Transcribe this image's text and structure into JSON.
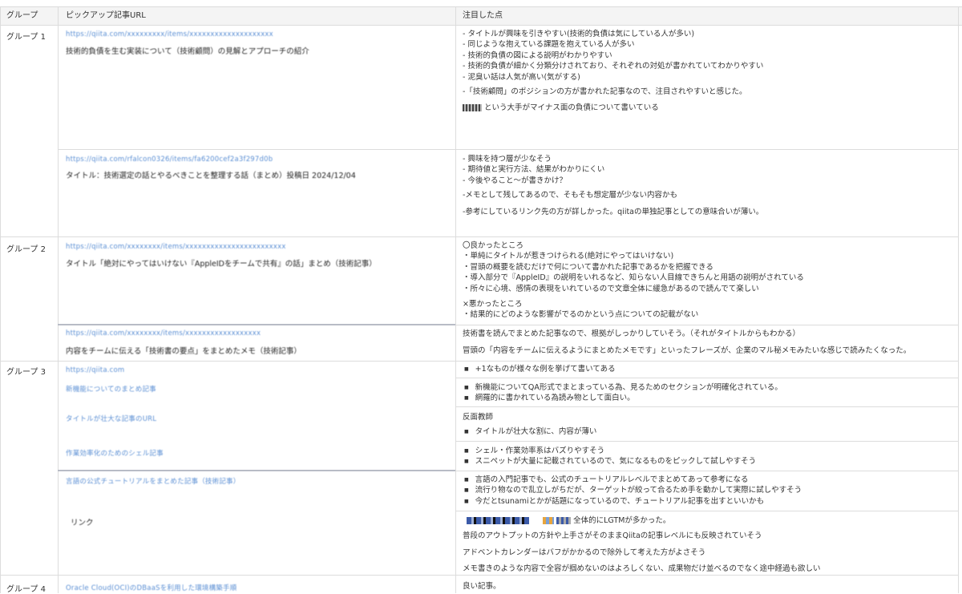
{
  "headers": {
    "group": "グループ",
    "url": "ピックアップ記事URL",
    "notes": "注目した点"
  },
  "groups": [
    "グループ 1",
    "グループ 2",
    "グループ 3",
    "グループ 4"
  ],
  "rows": {
    "r1": {
      "url": "https://qiita.com/xxxxxxxxx/items/xxxxxxxxxxxxxxxxxxxx",
      "title": "技術的負債を生む実装について（技術顧問）の見解とアプローチの紹介",
      "notes": [
        "- タイトルが興味を引きやすい(技術的負債は気にしている人が多い)",
        "- 同じような抱えている課題を抱えている人が多い",
        "- 技術的負債の図による説明がわかりやすい",
        "- 技術的負債が細かく分類分けされており、それぞれの対処が書かれていてわかりやすい",
        "- 泥臭い話は人気が高い(気がする)"
      ],
      "note2": "-「技術顧問」のポジションの方が書かれた記事なので、注目されやすいと感じた。",
      "note3": "という大手がマイナス面の負債について書いている"
    },
    "r2": {
      "url": "https://qiita.com/rfalcon0326/items/fa6200cef2a3f297d0b",
      "title": "タイトル：技術選定の話とやるべきことを整理する話（まとめ）投稿日 2024/12/04",
      "notes": [
        "- 興味を持つ層が少なそう",
        "- 期待値と実行方法、結果がわかりにくい",
        "- 今後やること～が書きかけ？"
      ],
      "note2": "-メモとして残してあるので、そもそも想定層が少ない内容かも",
      "note3": "-参考にしているリンク先の方が詳しかった。qiitaの単独記事としての意味合いが薄い。"
    },
    "r3": {
      "url": "https://qiita.com/xxxxxxxx/items/xxxxxxxxxxxxxxxxxxxxxxxx",
      "title": "タイトル「絶対にやってはいけない『AppleIDをチームで共有』の話」まとめ（技術記事）",
      "head1": "〇良かったところ",
      "notes": [
        "・単純にタイトルが惹きつけられる(絶対にやってはいけない)",
        "・冒頭の概要を読むだけで何について書かれた記事であるかを把握できる",
        "・導入部分で『AppleID』の説明をいれるなど、知らない人目線できちんと用語の説明がされている",
        "・所々に心境、感情の表現をいれているので文章全体に緩急があるので読んでて楽しい"
      ],
      "head2": "×悪かったところ",
      "bad": [
        "・結果的にどのような影響がでるのかという点についての記載がない"
      ]
    },
    "r4": {
      "url": "https://qiita.com/xxxxxxxx/items/xxxxxxxxxxxxxxxxxx",
      "title": "内容をチームに伝える「技術書の要点」をまとめたメモ（技術記事）",
      "note1": "技術書を読んでまとめた記事なので、根拠がしっかりしていそう。（それがタイトルからもわかる）",
      "note2": "冒頭の「内容をチームに伝えるようにまとめたメモです」といったフレーズが、企業のマル秘メモみたいな感じで読みたくなった。"
    },
    "r5": {
      "url": "https://qiita.com",
      "title": "",
      "bullets": [
        "+1なものが様々な例を挙げて書いてある"
      ]
    },
    "r6": {
      "url": "新機能についてのまとめ記事",
      "bullets": [
        "新機能についてQA形式でまとまっている為、見るためのセクションが明確化されている。",
        "網羅的に書かれている為読み物として面白い。"
      ]
    },
    "r7": {
      "url": "タイトルが壮大な記事のURL",
      "head": "反面教師",
      "bullets": [
        "タイトルが壮大な割に、内容が薄い"
      ]
    },
    "r8": {
      "url": "作業効率化のためのシェル記事",
      "bullets": [
        "シェル・作業効率系はバズりやすそう",
        "スニペットが大量に記載されているので、気になるものをピックして試しやすそう"
      ]
    },
    "r9": {
      "url": "言語の公式チュートリアルをまとめた記事（技術記事）",
      "title": "リンク",
      "bullets": [
        "言語の入門記事でも、公式のチュートリアルレベルでまとめてあって参考になる",
        "流行り物なので乱立しがちだが、ターゲットが絞って合るため手を動かして実際に試しやすそう",
        "今だとtsunamiとかが話題になっているので、チュートリアル記事を出すといいかも"
      ],
      "lgtm": "全体的にLGTMが多かった。",
      "note2": "普段のアウトプットの方針や上手さがそのままQiitaの記事レベルにも反映されていそう",
      "note3": "アドベントカレンダーはバフがかかるので除外して考えた方がよさそう",
      "note4": "メモ書きのような内容で全容が掴めないのはよろしくない、成果物だけ並べるのでなく途中経過も欲しい"
    },
    "r10": {
      "url": "Oracle Cloud(OCI)のDBaaSを利用した環境構築手順",
      "note1": "良い記事。"
    }
  },
  "colors": {
    "link": "#5b8fd4",
    "border": "#dcdcdc",
    "header_bg": "#f4f4f4"
  }
}
